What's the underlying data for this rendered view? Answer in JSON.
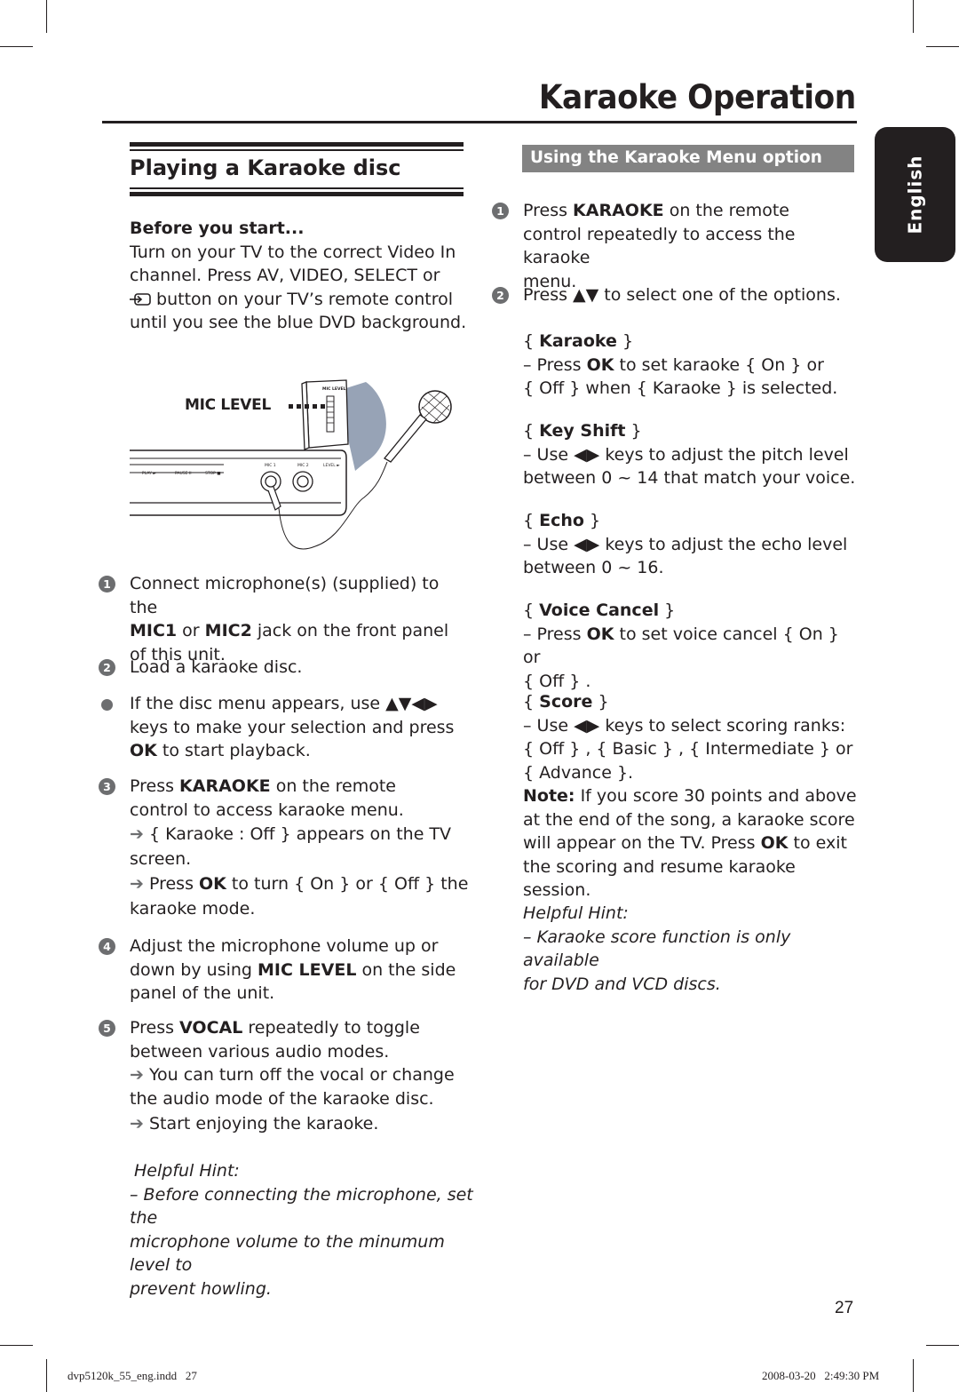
{
  "page": {
    "title": "Karaoke Operation",
    "language_tab": "English",
    "page_number": "27",
    "footer_left": "dvp5120k_55_eng.indd   27",
    "footer_right": "2008-03-20   2:49:30 PM"
  },
  "left": {
    "section_title": "Playing a Karaoke disc",
    "before_heading": "Before you start...",
    "before_text": [
      "Turn on your TV to the correct Video In",
      "channel. Press AV, VIDEO, SELECT or",
      "button on your TV’s remote control",
      "until you see the blue DVD background."
    ],
    "before_icon": "input-source-icon",
    "illustration": {
      "mic_level_label": "MIC LEVEL",
      "side_panel_label": "MIC LEVEL",
      "front_labels": [
        "PLAY ►",
        "PAUSE II",
        "STOP ■",
        "MIC 1",
        "MIC 2",
        "LEVEL ►"
      ]
    },
    "steps": [
      {
        "n": "1",
        "lines": [
          "Connect microphone(s) (supplied) to the"
        ],
        "line2_pre": "",
        "line2_b1": "MIC1",
        "line2_mid": " or ",
        "line2_b2": "MIC2",
        "line2_post": " jack on the front panel",
        "line3": "of this unit."
      },
      {
        "n": "2",
        "text": "Load a karaoke disc."
      },
      {
        "bullet": true,
        "line1": "If the disc menu appears, use ▲▼◀▶",
        "line2": "keys to make your selection and press",
        "line3_b": "OK",
        "line3": " to start playback."
      },
      {
        "n": "3",
        "pre": "Press ",
        "b": "KARAOKE",
        "post": " on the remote",
        "line2": "control to access karaoke menu.",
        "arrow1_a": "{ Karaoke : Off } appears on the TV",
        "arrow1_b": "screen.",
        "arrow2_pre": "Press ",
        "arrow2_b": "OK",
        "arrow2_post": " to turn { On } or { Off } the",
        "arrow2_c": "karaoke mode."
      },
      {
        "n": "4",
        "line1": "Adjust the microphone volume up or",
        "line2_pre": "down by using ",
        "line2_b": "MIC LEVEL",
        "line2_post": " on the side",
        "line3": "panel of the unit."
      },
      {
        "n": "5",
        "pre": "Press ",
        "b": "VOCAL",
        "post": " repeatedly to toggle",
        "line2": "between various audio modes.",
        "arrow1_a": "You can turn off the vocal or change",
        "arrow1_b": "the audio mode of the karaoke disc.",
        "arrow2": "Start enjoying the karaoke."
      }
    ],
    "hint_title": "Helpful Hint:",
    "hint_lines": [
      "–  Before connecting the microphone, set the",
      "microphone volume to the minumum level to",
      "prevent howling."
    ]
  },
  "right": {
    "section_title": "Using the Karaoke Menu option",
    "step1": {
      "n": "1",
      "pre": "Press ",
      "b": "KARAOKE",
      "post": " on the remote",
      "line2": "control repeatedly to access the karaoke",
      "line3": "menu."
    },
    "step2": {
      "n": "2",
      "text": "Press ▲▼ to select one of the options."
    },
    "options": [
      {
        "name": "Karaoke",
        "l1_pre": "– Press ",
        "l1_b": "OK",
        "l1_post": " to set karaoke { On } or",
        "l2": "{ Off } when { Karaoke } is selected."
      },
      {
        "name": "Key Shift",
        "l1_pre": "– Use ◀▶ keys to adjust the pitch level",
        "l1_b": "",
        "l1_post": "",
        "l2": "between 0 ~ 14 that match your voice."
      },
      {
        "name": "Echo",
        "l1_pre": "– Use ◀▶ keys to adjust the echo level",
        "l1_b": "",
        "l1_post": "",
        "l2": "between 0 ~ 16."
      },
      {
        "name": "Voice Cancel",
        "l1_pre": "– Press ",
        "l1_b": "OK",
        "l1_post": " to set voice cancel { On } or",
        "l2": "{ Off } ."
      },
      {
        "name": "Score",
        "l1_pre": "– Use ◀▶ keys to select scoring ranks:",
        "l1_b": "",
        "l1_post": "",
        "l2": "{ Off } ,  { Basic } , { Intermediate } or",
        "l3": "{ Advance }."
      }
    ],
    "note_label": "Note:",
    "note_lines": [
      " If you score 30 points and above",
      "at the end of the song, a karaoke score"
    ],
    "note_l3_pre": "will appear on the TV. Press ",
    "note_l3_b": "OK",
    "note_l3_post": " to exit",
    "note_l4": "the scoring and resume karaoke session.",
    "hint_title": "Helpful Hint:",
    "hint_lines": [
      "–   Karaoke score function is only available",
      "for DVD and VCD discs."
    ]
  }
}
